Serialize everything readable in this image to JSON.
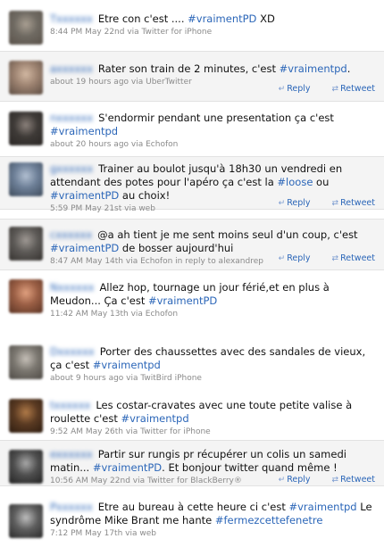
{
  "tweets": [
    {
      "author": "T",
      "segments": [
        {
          "t": "Etre con c'est .... "
        },
        {
          "h": "#vraimentPD"
        },
        {
          "t": " XD"
        }
      ],
      "meta": "8:44 PM May 22nd via Twitter for iPhone",
      "actions": false,
      "avatar_colors": [
        "#6f6a62",
        "#a89e91",
        "#5a524a"
      ]
    },
    {
      "author": "a",
      "segments": [
        {
          "t": "Rater son train de 2 minutes, c'est "
        },
        {
          "h": "#vraimentpd"
        },
        {
          "t": "."
        }
      ],
      "meta": "about 19 hours ago via UberTwitter",
      "actions": true,
      "avatar_colors": [
        "#9c8270",
        "#d1b7a1",
        "#5d4d43"
      ]
    },
    {
      "author": "n",
      "segments": [
        {
          "t": "S'endormir pendant une presentation ça c'est "
        },
        {
          "h": "#vraimentpd"
        }
      ],
      "meta": "about 20 hours ago via Echofon",
      "actions": false,
      "avatar_colors": [
        "#3e3a37",
        "#8a807a",
        "#2b2725"
      ]
    },
    {
      "author": "g",
      "segments": [
        {
          "t": "Trainer au boulot jusqu'à 18h30 un vendredi en attendant des potes pour l'apéro ça c'est la "
        },
        {
          "h": "#loose"
        },
        {
          "t": " ou "
        },
        {
          "h": "#vraimentPD"
        },
        {
          "t": " au choix!"
        }
      ],
      "meta": "5:59 PM May 21st via web",
      "actions": true,
      "avatar_colors": [
        "#6d7f97",
        "#b1bfd1",
        "#3f4c5c"
      ]
    },
    {
      "author": "c",
      "segments": [
        {
          "t": "@a ah tient je me sent moins seul d'un coup, c'est "
        },
        {
          "h": "#vraimentPD"
        },
        {
          "t": " de bosser aujourd'hui"
        }
      ],
      "meta": "8:47 AM May 14th via Echofon in reply to alexandrep",
      "actions": true,
      "avatar_colors": [
        "#5d5a57",
        "#9e9893",
        "#35322f"
      ]
    },
    {
      "author": "N",
      "segments": [
        {
          "t": "Allez hop, tournage un jour férié,et en plus à Meudon... Ça c'est "
        },
        {
          "h": "#vraimentPD"
        }
      ],
      "meta": "11:42 AM May 13th via Echofon",
      "actions": false,
      "avatar_colors": [
        "#9b5f45",
        "#e0a07f",
        "#5b3424"
      ]
    },
    {
      "author": "D",
      "segments": [
        {
          "t": "Porter des chaussettes avec des sandales de vieux, ça c'est "
        },
        {
          "h": "#vraimentpd"
        }
      ],
      "meta": "about 9 hours ago via TwitBird iPhone",
      "actions": false,
      "avatar_colors": [
        "#7b7770",
        "#c5bfb7",
        "#4e4a45"
      ]
    },
    {
      "author": "t",
      "segments": [
        {
          "t": "Les costar-cravates avec une toute petite valise à roulette c'est "
        },
        {
          "h": "#vraimentpd"
        }
      ],
      "meta": "9:52 AM May 26th via Twitter for iPhone",
      "actions": false,
      "avatar_colors": [
        "#5a3a22",
        "#b07a48",
        "#2d1c10"
      ]
    },
    {
      "author": "e",
      "segments": [
        {
          "t": "Partir sur rungis pr récupérer un colis un samedi matin... "
        },
        {
          "h": "#vraimentPD"
        },
        {
          "t": ". Et bonjour twitter quand même !"
        }
      ],
      "meta": "10:56 AM May 22nd via Twitter for BlackBerry®",
      "actions": true,
      "avatar_colors": [
        "#4f4f4f",
        "#a7a7a7",
        "#222222"
      ]
    },
    {
      "author": "P",
      "segments": [
        {
          "t": "Etre au bureau à cette heure ci c'est "
        },
        {
          "h": "#vraimentpd"
        },
        {
          "t": " Le syndrôme Mike Brant me hante "
        },
        {
          "h": "#fermezcettefenetre"
        }
      ],
      "meta": "7:12 PM May 17th via web",
      "actions": false,
      "avatar_colors": [
        "#5e5e5e",
        "#bdbdbd",
        "#2a2a2a"
      ]
    }
  ],
  "labels": {
    "reply": "Reply",
    "retweet": "Retweet"
  },
  "colors": {
    "link": "#2b66b8",
    "meta": "#8a8a8a"
  }
}
